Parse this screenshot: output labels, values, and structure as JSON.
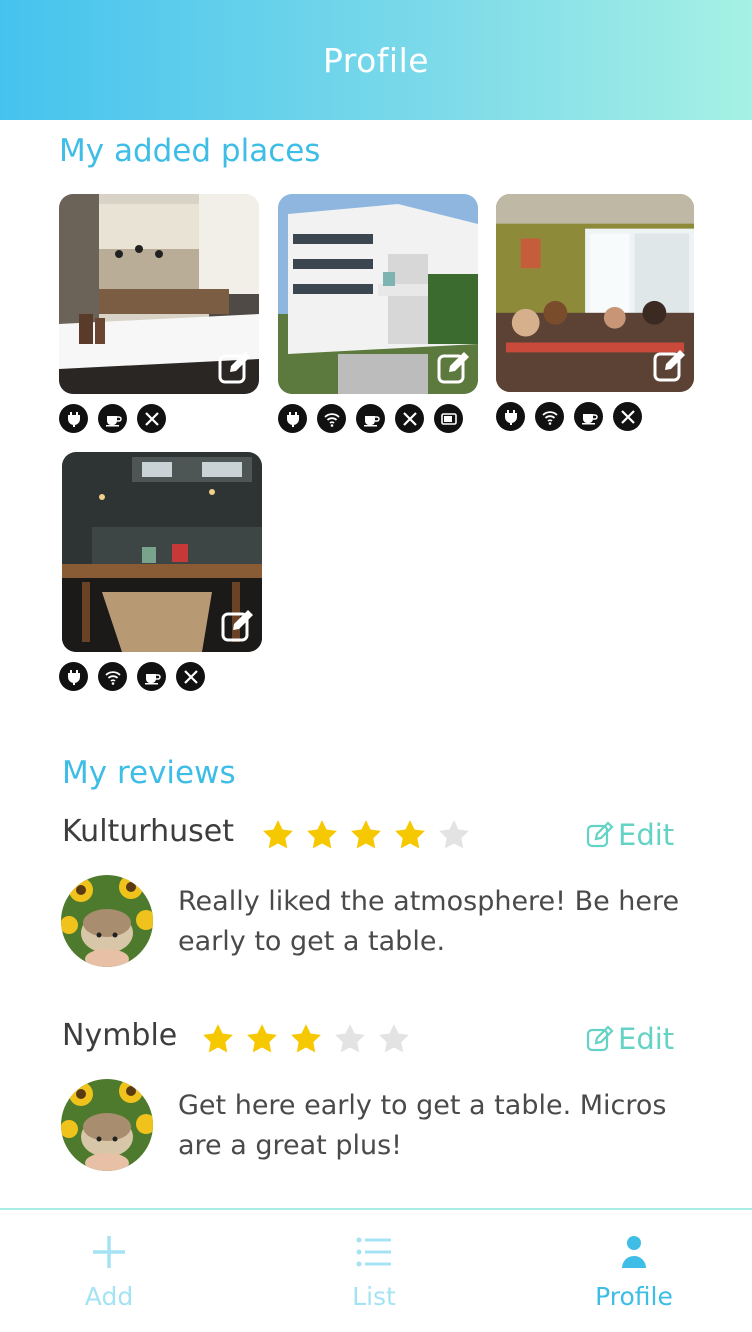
{
  "header": {
    "title": "Profile"
  },
  "places_section": {
    "title": "My added places"
  },
  "places": [
    {
      "amenities": [
        "plug-icon",
        "coffee-icon",
        "cutlery-icon"
      ]
    },
    {
      "amenities": [
        "plug-icon",
        "wifi-icon",
        "coffee-icon",
        "cutlery-icon",
        "microwave-icon"
      ]
    },
    {
      "amenities": [
        "plug-icon",
        "wifi-icon",
        "coffee-icon",
        "cutlery-icon"
      ]
    },
    {
      "amenities": [
        "plug-icon",
        "wifi-icon",
        "coffee-icon",
        "cutlery-icon"
      ]
    }
  ],
  "reviews_section": {
    "title": "My reviews"
  },
  "reviews": [
    {
      "place": "Kulturhuset",
      "rating": 4,
      "max_rating": 5,
      "edit_label": "Edit",
      "text": "Really liked the atmosphere! Be here early to get a table."
    },
    {
      "place": "Nymble",
      "rating": 3,
      "max_rating": 5,
      "edit_label": "Edit",
      "text": "Get here early to get a table. Micros are a great plus!"
    }
  ],
  "tabbar": {
    "tabs": [
      {
        "label": "Add",
        "icon": "plus-icon",
        "active": false
      },
      {
        "label": "List",
        "icon": "list-icon",
        "active": false
      },
      {
        "label": "Profile",
        "icon": "person-icon",
        "active": true
      }
    ]
  },
  "colors": {
    "accent": "#3ebde6",
    "edit": "#64d2c4",
    "star_on": "#f6c800",
    "star_off": "#e3e3e3",
    "tab_inactive": "#a5e3f4"
  }
}
